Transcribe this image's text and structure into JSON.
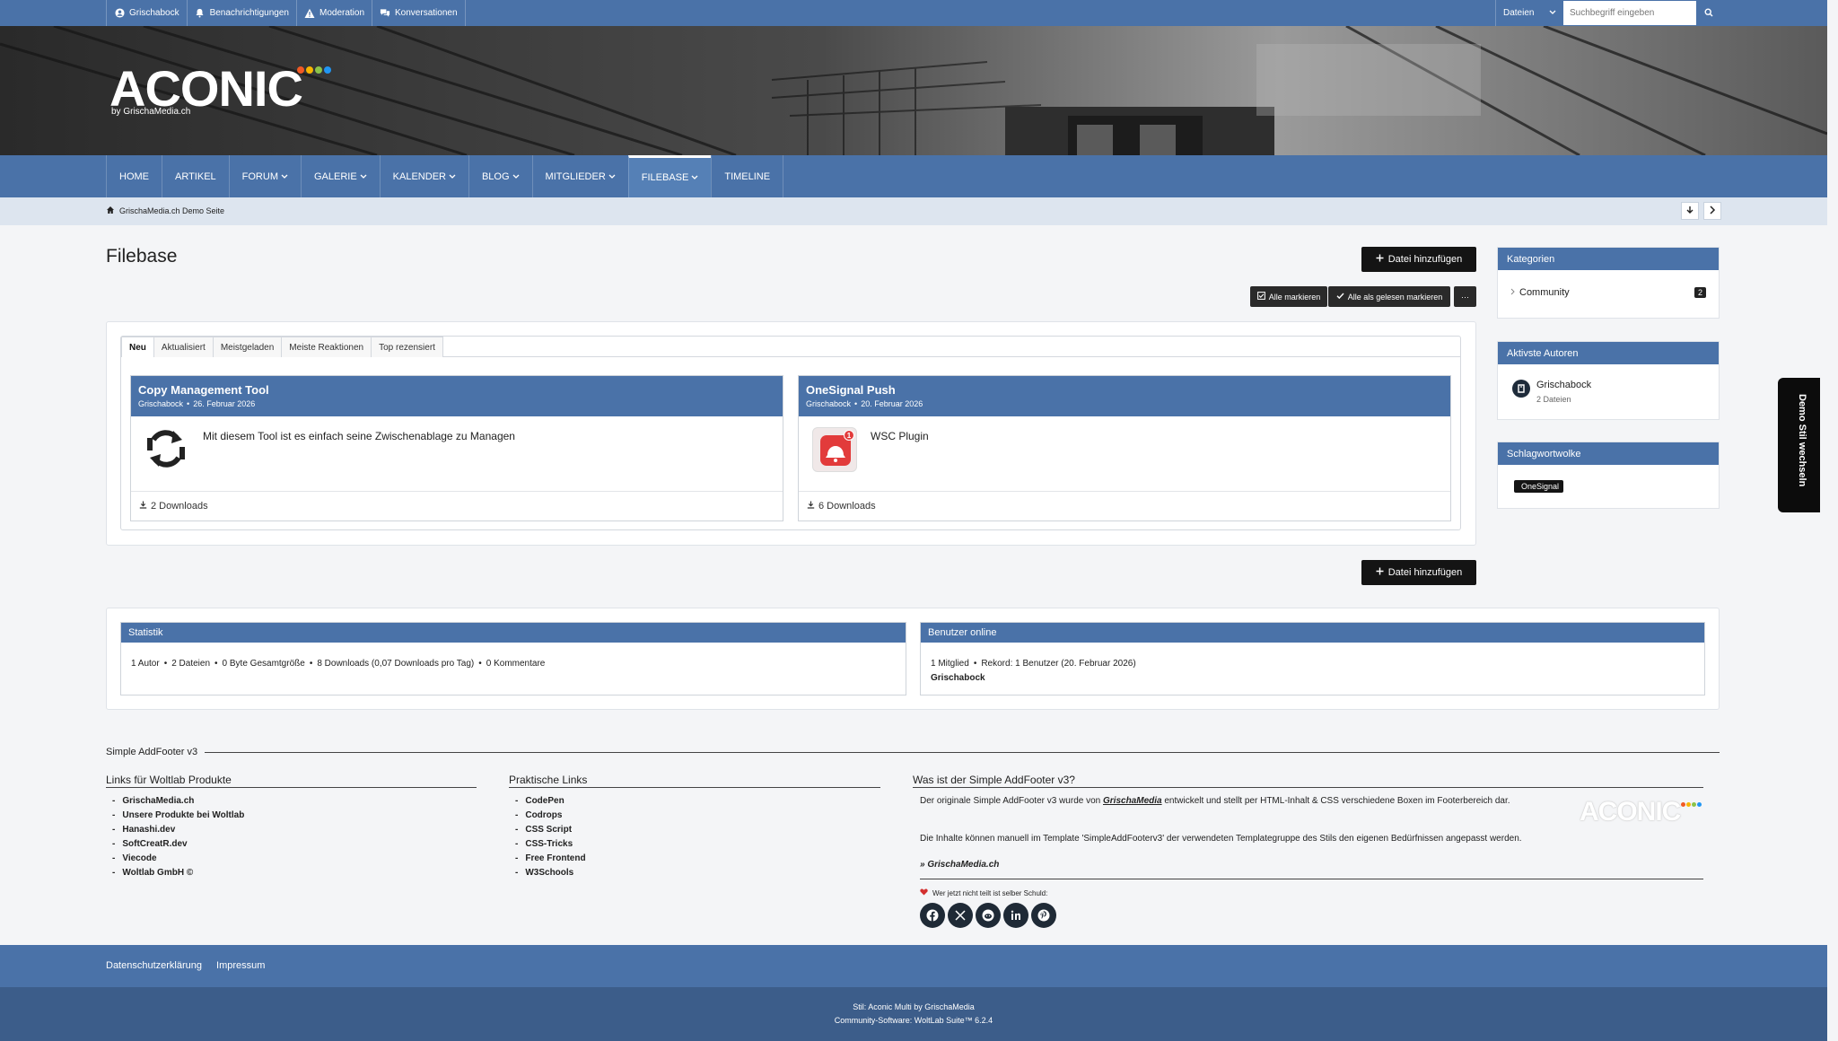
{
  "userbar": {
    "items": [
      {
        "label": "Grischabock",
        "icon": "user-circle-icon"
      },
      {
        "label": "Benachrichtigungen",
        "icon": "bell-icon"
      },
      {
        "label": "Moderation",
        "icon": "warning-icon"
      },
      {
        "label": "Konversationen",
        "icon": "comments-icon"
      }
    ],
    "search_scope": "Dateien",
    "search_placeholder": "Suchbegriff eingeben"
  },
  "logo": {
    "text": "ACONIC",
    "sub": "by GrischaMedia.ch",
    "dots": [
      "#f15a24",
      "#f7b500",
      "#8bc34a",
      "#2196f3"
    ]
  },
  "nav": [
    {
      "label": "HOME",
      "dropdown": false
    },
    {
      "label": "ARTIKEL",
      "dropdown": false
    },
    {
      "label": "FORUM",
      "dropdown": true
    },
    {
      "label": "GALERIE",
      "dropdown": true
    },
    {
      "label": "KALENDER",
      "dropdown": true
    },
    {
      "label": "BLOG",
      "dropdown": true
    },
    {
      "label": "MITGLIEDER",
      "dropdown": true
    },
    {
      "label": "FILEBASE",
      "dropdown": true,
      "active": true
    },
    {
      "label": "TIMELINE",
      "dropdown": false
    }
  ],
  "breadcrumb": "GrischaMedia.ch Demo Seite",
  "page": {
    "title": "Filebase",
    "add_file": "Datei hinzufügen",
    "mark_all": "Alle markieren",
    "mark_all_read": "Alle als gelesen markieren",
    "more": "···"
  },
  "tabs": [
    "Neu",
    "Aktualisiert",
    "Meistgeladen",
    "Meiste Reaktionen",
    "Top rezensiert"
  ],
  "files": [
    {
      "title": "Copy Management Tool",
      "author": "Grischabock",
      "date": "26. Februar 2026",
      "desc": "Mit diesem Tool ist es einfach seine Zwischenablage zu Managen",
      "downloads": "2 Downloads"
    },
    {
      "title": "OneSignal Push",
      "author": "Grischabock",
      "date": "20. Februar 2026",
      "desc": "WSC Plugin",
      "downloads": "6 Downloads",
      "badge": "1"
    }
  ],
  "sidebar": {
    "categories": {
      "title": "Kategorien",
      "items": [
        {
          "label": "Community",
          "count": "2"
        }
      ]
    },
    "authors": {
      "title": "Aktivste Autoren",
      "items": [
        {
          "name": "Grischabock",
          "sub": "2 Dateien"
        }
      ]
    },
    "tags": {
      "title": "Schlagwortwolke",
      "items": [
        "OneSignal"
      ]
    }
  },
  "stats": {
    "title": "Statistik",
    "items": [
      "1 Autor",
      "2 Dateien",
      "0 Byte Gesamtgröße",
      "8 Downloads (0,07 Downloads pro Tag)",
      "0 Kommentare"
    ]
  },
  "online": {
    "title": "Benutzer online",
    "items": [
      "1 Mitglied",
      "Rekord: 1 Benutzer (20. Februar 2026)"
    ],
    "users": "Grischabock"
  },
  "addfooter": {
    "title": "Simple AddFooter v3",
    "col1": {
      "title": "Links für Woltlab Produkte",
      "links": [
        "GrischaMedia.ch",
        "Unsere Produkte bei Woltlab",
        "Hanashi.dev",
        "SoftCreatR.dev",
        "Viecode",
        "Woltlab GmbH ©"
      ]
    },
    "col2": {
      "title": "Praktische Links",
      "links": [
        "CodePen",
        "Codrops",
        "CSS Script",
        "CSS-Tricks",
        "Free Frontend",
        "W3Schools"
      ]
    },
    "col3": {
      "title": "Was ist der Simple AddFooter v3?",
      "p1_before": "Der originale Simple AddFooter v3 wurde von ",
      "p1_em": "GrischaMedia",
      "p1_after": " entwickelt und stellt per HTML-Inhalt & CSS verschiedene Boxen im Footerbereich dar.",
      "p2": "Die Inhalte können manuell im Template 'SimpleAddFooterv3' der verwendeten Templategruppe des Stils den eigenen Bedürfnissen angepasst werden.",
      "link": "» GrischaMedia.ch",
      "share_text": "Wer jetzt nicht teilt ist selber Schuld:",
      "logo": "ACONIC"
    },
    "social": [
      "facebook-icon",
      "x-icon",
      "reddit-icon",
      "linkedin-icon",
      "pinterest-icon"
    ]
  },
  "footer": {
    "links": [
      "Datenschutzerklärung",
      "Impressum"
    ],
    "line1": "Stil: Aconic Multi by GrischaMedia",
    "line2": "Community-Software: WoltLab Suite™ 6.2.4"
  },
  "demo_switch": "Demo Stil wechseln"
}
